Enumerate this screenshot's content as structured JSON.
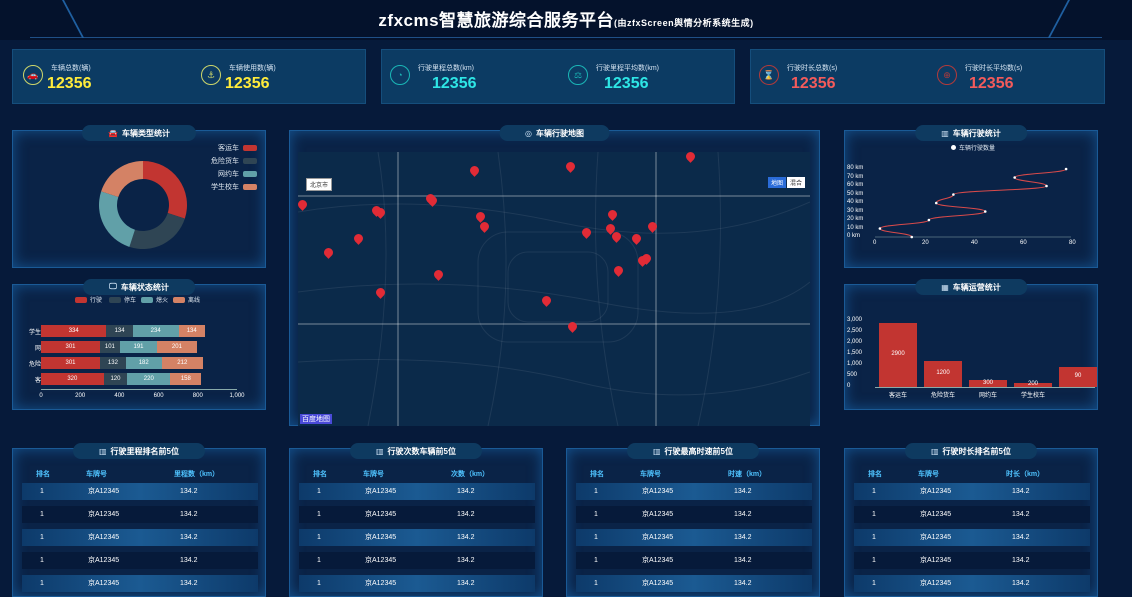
{
  "header": {
    "title": "zfxcms智慧旅游综合服务平台",
    "subtitle": "(由zfxScreen舆情分析系统生成)"
  },
  "kpis": [
    {
      "label": "车辆总数(辆)",
      "value": "12356",
      "icon": "car-icon",
      "color": "#ffeb3b",
      "icon_color": "#cdd66a",
      "glyph": "🚗"
    },
    {
      "label": "车辆使用数(辆)",
      "value": "12356",
      "icon": "anchor-icon",
      "color": "#ffeb3b",
      "icon_color": "#cdd66a",
      "glyph": "⚓"
    },
    {
      "label": "行驶里程总数(km)",
      "value": "12356",
      "icon": "gauge-icon",
      "color": "#2ee6e6",
      "icon_color": "#1ab6b6",
      "glyph": "◔"
    },
    {
      "label": "行驶里程平均数(km)",
      "value": "12356",
      "icon": "scale-icon",
      "color": "#2ee6e6",
      "icon_color": "#1ab6b6",
      "glyph": "⚖"
    },
    {
      "label": "行驶时长总数(s)",
      "value": "12356",
      "icon": "hourglass-icon",
      "color": "#f45b5b",
      "icon_color": "#b23a3a",
      "glyph": "⌛"
    },
    {
      "label": "行驶时长平均数(s)",
      "value": "12356",
      "icon": "compass-icon",
      "color": "#f45b5b",
      "icon_color": "#b23a3a",
      "glyph": "⊕"
    }
  ],
  "panels": {
    "vehicle_type": "车辆类型统计",
    "vehicle_status": "车辆状态统计",
    "map": "车辆行驶地图",
    "driving": "车辆行驶统计",
    "operation": "车辆运营统计",
    "rank_mileage": "行驶里程排名前5位",
    "rank_trips": "行驶次数车辆前5位",
    "rank_speed": "行驶最高时速前5位",
    "rank_duration": "行驶时长排名前5位"
  },
  "colors": {
    "red": "#c23531",
    "dark": "#2f4554",
    "teal": "#61a0a8",
    "salmon": "#d48265"
  },
  "chart_data": [
    {
      "type": "pie",
      "donut": true,
      "legend_position": "top-right",
      "labels": [
        "客运车",
        "危险货车",
        "网约车",
        "学生校车"
      ],
      "values": [
        30,
        25,
        25,
        20
      ]
    },
    {
      "type": "bar",
      "orientation": "horizontal",
      "stacked": true,
      "legend_position": "top",
      "categories": [
        "学生校车",
        "网约车",
        "危险货车",
        "客运车"
      ],
      "series": [
        {
          "name": "行驶",
          "values": [
            334,
            301,
            301,
            320
          ]
        },
        {
          "name": "停车",
          "values": [
            134,
            101,
            132,
            120
          ]
        },
        {
          "name": "熄火",
          "values": [
            234,
            191,
            182,
            220
          ]
        },
        {
          "name": "离线",
          "values": [
            134,
            201,
            212,
            158
          ]
        }
      ],
      "xlim": [
        0,
        1000
      ],
      "xticks": [
        "0",
        "200",
        "400",
        "600",
        "800",
        "1,000"
      ],
      "seg_labels": [
        [
          "334",
          "134",
          "234",
          "134"
        ],
        [
          "301",
          "101",
          "191",
          "201"
        ],
        [
          "301",
          "132",
          "182",
          "212"
        ],
        [
          "320",
          "120",
          "220",
          "158"
        ]
      ]
    },
    {
      "type": "line",
      "legend_position": "top",
      "series": [
        {
          "name": "车辆行驶数量"
        }
      ],
      "x": [
        15,
        2,
        22,
        45,
        25,
        32,
        70,
        57,
        78
      ],
      "y": [
        0,
        10,
        20,
        30,
        40,
        50,
        60,
        70,
        80
      ],
      "xticks": [
        "0",
        "20",
        "40",
        "60",
        "80"
      ],
      "yticks": [
        "0 km",
        "10 km",
        "20 km",
        "30 km",
        "40 km",
        "50 km",
        "60 km",
        "70 km",
        "80 km"
      ],
      "xlim": [
        0,
        80
      ],
      "ylim": [
        0,
        80
      ]
    },
    {
      "type": "bar",
      "categories": [
        "客运车",
        "危险货车",
        "网约车",
        "学生校车",
        ""
      ],
      "values": [
        2900,
        1200,
        300,
        200,
        900
      ],
      "bar_labels": [
        "2900",
        "1200",
        "300",
        "200",
        "90"
      ],
      "yticks": [
        "0",
        "500",
        "1,000",
        "1,500",
        "2,000",
        "2,500",
        "3,000"
      ],
      "ylim": [
        0,
        3000
      ]
    }
  ],
  "map": {
    "city_button": "北京市",
    "type_map": "地图",
    "type_satellite": "混合",
    "logo": "百度地图"
  },
  "tables": [
    {
      "headers": [
        "排名",
        "车牌号",
        "里程数（km）"
      ],
      "rows": [
        [
          "1",
          "京A12345",
          "134.2"
        ],
        [
          "1",
          "京A12345",
          "134.2"
        ],
        [
          "1",
          "京A12345",
          "134.2"
        ],
        [
          "1",
          "京A12345",
          "134.2"
        ],
        [
          "1",
          "京A12345",
          "134.2"
        ]
      ]
    },
    {
      "headers": [
        "排名",
        "车牌号",
        "次数（km）"
      ],
      "rows": [
        [
          "1",
          "京A12345",
          "134.2"
        ],
        [
          "1",
          "京A12345",
          "134.2"
        ],
        [
          "1",
          "京A12345",
          "134.2"
        ],
        [
          "1",
          "京A12345",
          "134.2"
        ],
        [
          "1",
          "京A12345",
          "134.2"
        ]
      ]
    },
    {
      "headers": [
        "排名",
        "车牌号",
        "时速（km）"
      ],
      "rows": [
        [
          "1",
          "京A12345",
          "134.2"
        ],
        [
          "1",
          "京A12345",
          "134.2"
        ],
        [
          "1",
          "京A12345",
          "134.2"
        ],
        [
          "1",
          "京A12345",
          "134.2"
        ],
        [
          "1",
          "京A12345",
          "134.2"
        ]
      ]
    },
    {
      "headers": [
        "排名",
        "车牌号",
        "时长（km）"
      ],
      "rows": [
        [
          "1",
          "京A12345",
          "134.2"
        ],
        [
          "1",
          "京A12345",
          "134.2"
        ],
        [
          "1",
          "京A12345",
          "134.2"
        ],
        [
          "1",
          "京A12345",
          "134.2"
        ],
        [
          "1",
          "京A12345",
          "134.2"
        ]
      ]
    }
  ]
}
